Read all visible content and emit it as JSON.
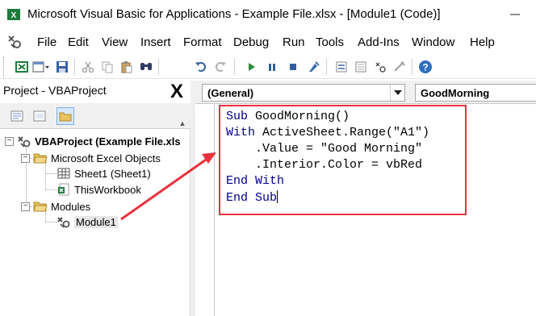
{
  "window": {
    "title": "Microsoft Visual Basic for Applications - Example File.xlsx - [Module1 (Code)]",
    "minimize_icon": "minimize-icon"
  },
  "menu": {
    "items": [
      "File",
      "Edit",
      "View",
      "Insert",
      "Format",
      "Debug",
      "Run",
      "Tools",
      "Add-Ins",
      "Window",
      "Help"
    ]
  },
  "toolbar": {
    "icons": [
      "excel-icon",
      "insert-module-icon",
      "save-icon",
      "cut-icon",
      "copy-icon",
      "paste-icon",
      "find-icon",
      "undo-icon",
      "redo-icon",
      "run-icon",
      "break-icon",
      "reset-icon",
      "design-mode-icon",
      "project-explorer-icon",
      "properties-icon",
      "object-browser-icon",
      "toolbox-icon",
      "help-icon"
    ]
  },
  "project": {
    "title": "Project - VBAProject",
    "close_label": "X",
    "tree": {
      "root": "VBAProject (Example File.xls",
      "excel_objects": "Microsoft Excel Objects",
      "sheet1": "Sheet1 (Sheet1)",
      "thisworkbook": "ThisWorkbook",
      "modules": "Modules",
      "module1": "Module1"
    }
  },
  "code": {
    "object_combo": "(General)",
    "procedure_combo": "GoodMorning",
    "lines": [
      {
        "kw": "Sub",
        "rest": " GoodMorning()"
      },
      {
        "kw": "With",
        "rest": " ActiveSheet.Range(\"A1\")"
      },
      {
        "kw": "",
        "rest": "    .Value = \"Good Morning\""
      },
      {
        "kw": "",
        "rest": "    .Interior.Color = vbRed"
      },
      {
        "kw": "End With",
        "rest": ""
      },
      {
        "kw": "End Sub",
        "rest": ""
      }
    ]
  },
  "colors": {
    "highlight": "#e8323c",
    "keyword": "#00008b"
  }
}
